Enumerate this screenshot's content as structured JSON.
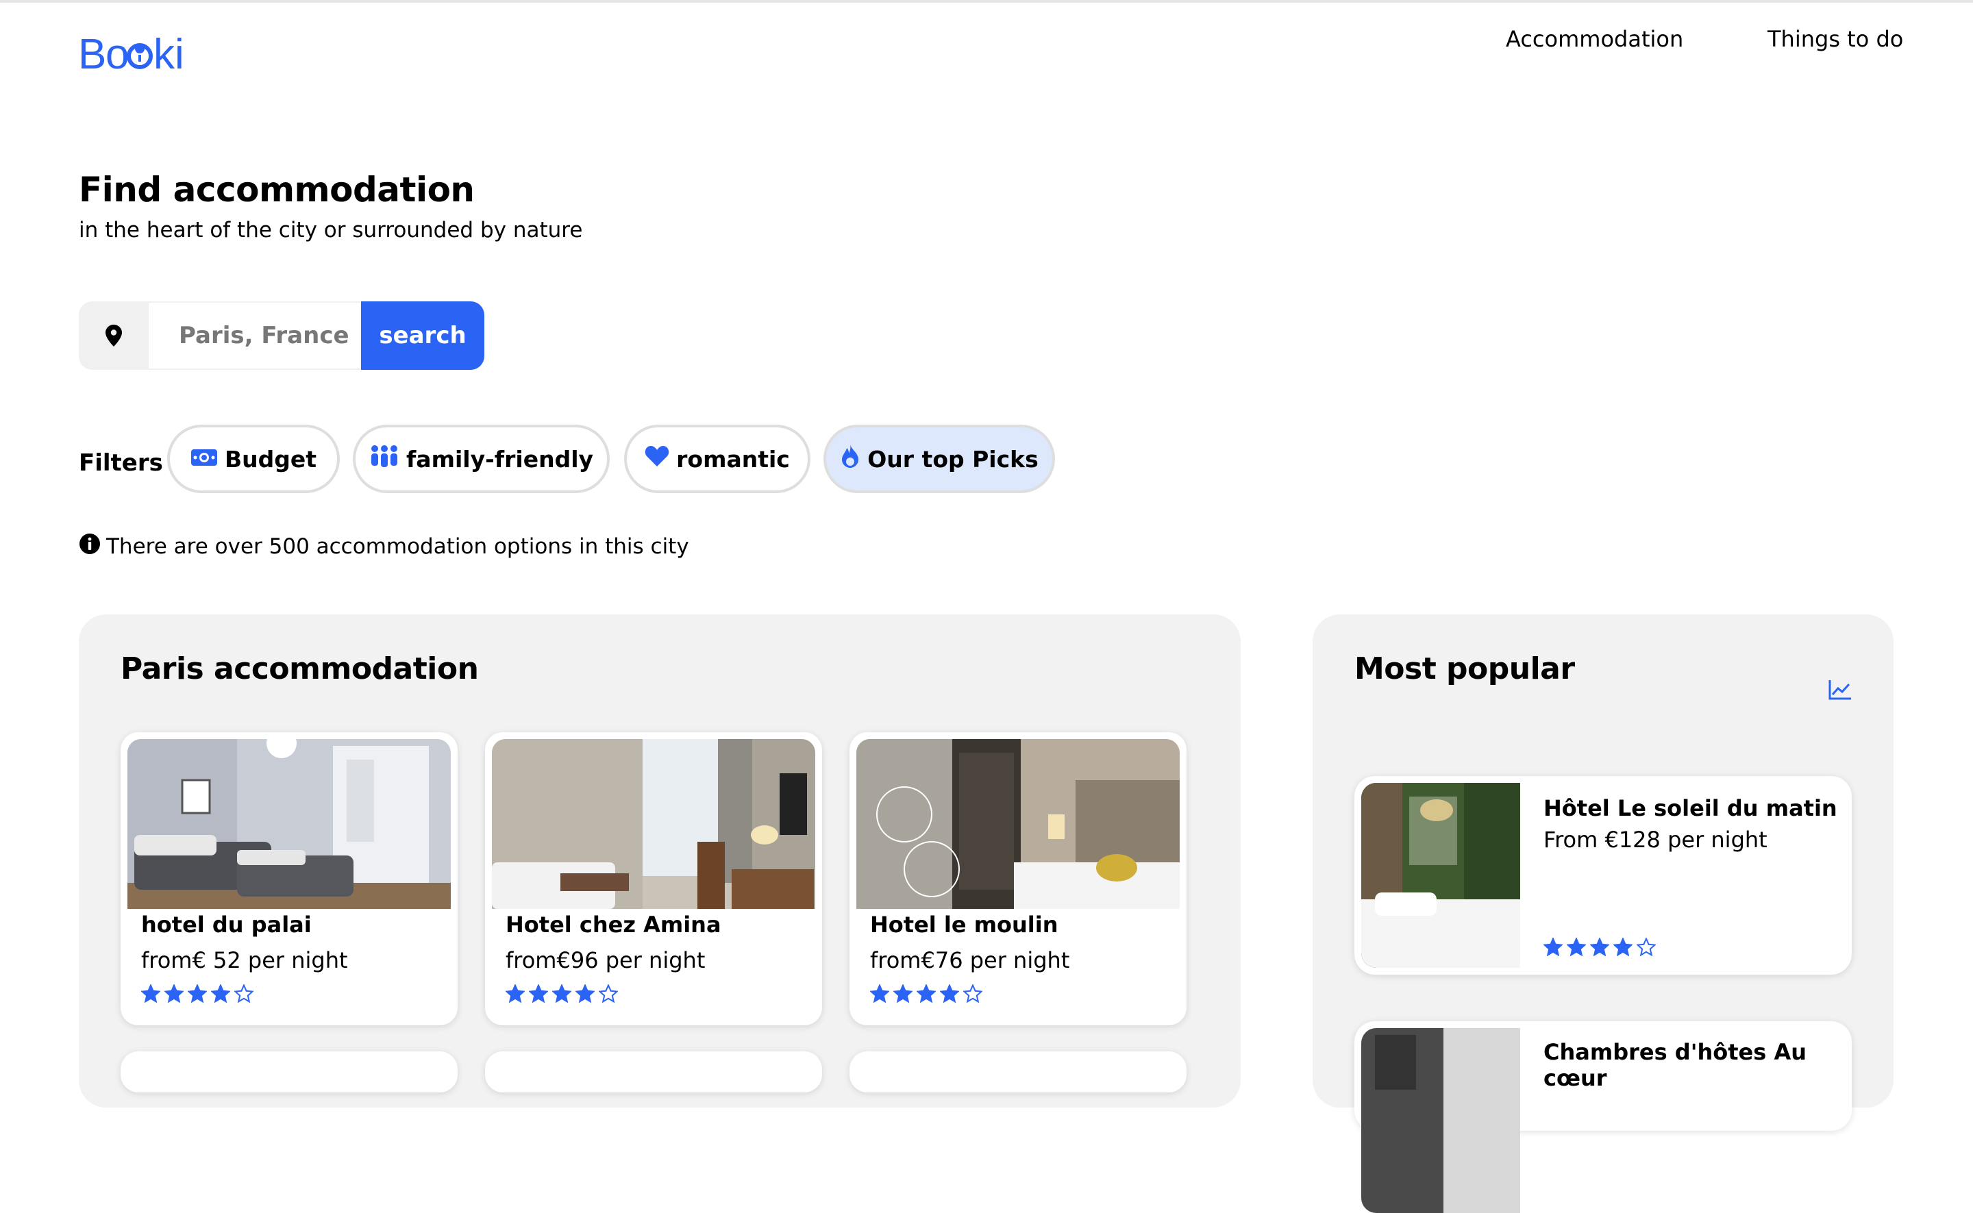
{
  "brand": {
    "name": "Booki",
    "color": "#2b63f5"
  },
  "nav": {
    "accommodation": "Accommodation",
    "things_to_do": "Things to do"
  },
  "hero": {
    "title": "Find accommodation",
    "subtitle": "in the heart of the city or surrounded by nature"
  },
  "search": {
    "placeholder": "Paris, France",
    "button": "search",
    "icon": "map-pin-icon"
  },
  "filters": {
    "label": "Filters",
    "items": [
      {
        "label": "Budget",
        "icon": "money-icon",
        "active": false
      },
      {
        "label": "family-friendly",
        "icon": "family-icon",
        "active": false
      },
      {
        "label": "romantic",
        "icon": "heart-icon",
        "active": false
      },
      {
        "label": "Our top Picks",
        "icon": "fire-icon",
        "active": true
      }
    ]
  },
  "info": {
    "text": "There are over 500 accommodation options in this city",
    "icon": "info-icon"
  },
  "accommodation": {
    "title": "Paris accommodation",
    "cards": [
      {
        "name": "hotel du palai",
        "price": "from€ 52 per night",
        "rating": 4,
        "max": 5
      },
      {
        "name": "Hotel chez Amina",
        "price": "from€96 per night",
        "rating": 4,
        "max": 5
      },
      {
        "name": "Hotel le moulin",
        "price": "from€76 per night",
        "rating": 4,
        "max": 5
      }
    ]
  },
  "popular": {
    "title": "Most popular",
    "icon": "trend-chart-icon",
    "cards": [
      {
        "name": "Hôtel Le soleil du matin",
        "price": "From €128 per night",
        "rating": 4,
        "max": 5
      },
      {
        "name": "Chambres d'hôtes Au cœur"
      }
    ]
  },
  "colors": {
    "accent": "#2b63f5",
    "panel_bg": "#f2f2f2",
    "active_filter_bg": "#dee8fc"
  }
}
